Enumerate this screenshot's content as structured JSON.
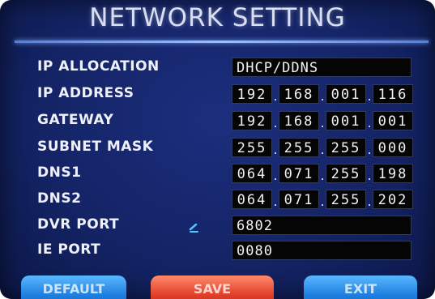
{
  "title": "NETWORK SETTING",
  "fields": {
    "ip_allocation": {
      "label": "IP ALLOCATION",
      "value": "DHCP/DDNS"
    },
    "ip_address": {
      "label": "IP ADDRESS",
      "octets": [
        "192",
        "168",
        "001",
        "116"
      ]
    },
    "gateway": {
      "label": "GATEWAY",
      "octets": [
        "192",
        "168",
        "001",
        "001"
      ]
    },
    "subnet_mask": {
      "label": "SUBNET MASK",
      "octets": [
        "255",
        "255",
        "255",
        "000"
      ]
    },
    "dns1": {
      "label": "DNS1",
      "octets": [
        "064",
        "071",
        "255",
        "198"
      ]
    },
    "dns2": {
      "label": "DNS2",
      "octets": [
        "064",
        "071",
        "255",
        "202"
      ]
    },
    "dvr_port": {
      "label": "DVR PORT",
      "value": "6802"
    },
    "ie_port": {
      "label": "IE PORT",
      "value": "0080"
    }
  },
  "buttons": {
    "default_label": "DEFAULT",
    "save_label": "SAVE",
    "exit_label": "EXIT"
  },
  "colors": {
    "background": "#142466",
    "field_background": "#050505",
    "button_blue": "#1e7fe0",
    "button_red": "#e0402a"
  }
}
